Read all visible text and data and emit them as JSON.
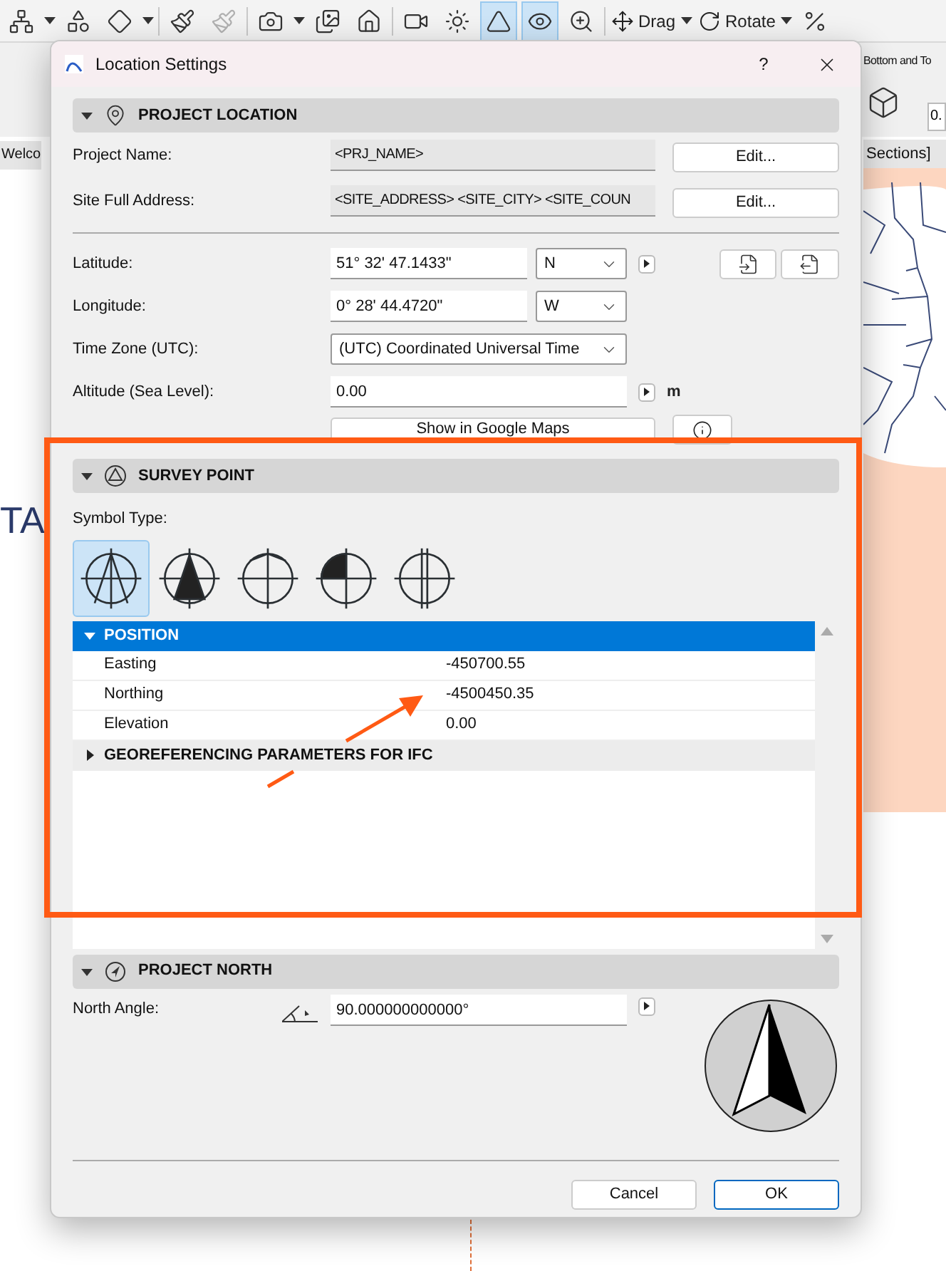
{
  "toolbar": {
    "items": [
      {
        "kind": "icon",
        "selected": false,
        "disabled": false
      },
      {
        "kind": "caret"
      },
      {
        "kind": "icon",
        "selected": false,
        "disabled": false
      },
      {
        "kind": "icon",
        "selected": false,
        "disabled": false
      },
      {
        "kind": "caret"
      },
      {
        "kind": "separator"
      },
      {
        "kind": "icon",
        "selected": false,
        "disabled": false
      },
      {
        "kind": "icon",
        "selected": false,
        "disabled": true
      },
      {
        "kind": "separator"
      },
      {
        "kind": "icon",
        "selected": false,
        "disabled": false
      },
      {
        "kind": "caret"
      },
      {
        "kind": "icon",
        "selected": false,
        "disabled": false
      },
      {
        "kind": "icon",
        "selected": false,
        "disabled": false
      },
      {
        "kind": "separator"
      },
      {
        "kind": "icon",
        "selected": false,
        "disabled": false
      },
      {
        "kind": "icon",
        "selected": false,
        "disabled": false
      },
      {
        "kind": "icon",
        "selected": true,
        "disabled": false
      },
      {
        "kind": "icon",
        "selected": true,
        "disabled": false
      },
      {
        "kind": "icon",
        "selected": false,
        "disabled": false
      },
      {
        "kind": "separator"
      },
      {
        "kind": "labeled",
        "label": "Drag"
      },
      {
        "kind": "caret"
      },
      {
        "kind": "labeled",
        "label": "Rotate"
      },
      {
        "kind": "caret"
      },
      {
        "kind": "icon",
        "selected": false,
        "disabled": false
      }
    ]
  },
  "background": {
    "left_tab": "Welco",
    "left_heading": "TA",
    "right_label": "Bottom and To",
    "right_value": "0.",
    "right_tab": "Sections]"
  },
  "dialog": {
    "title": "Location Settings",
    "help": "?",
    "project_location": {
      "title": "PROJECT LOCATION",
      "expanded": true,
      "project_name": {
        "label": "Project Name:",
        "value": "<PRJ_NAME>",
        "button": "Edit..."
      },
      "site_address": {
        "label": "Site Full Address:",
        "value": "<SITE_ADDRESS>  <SITE_CITY>  <SITE_COUN",
        "button": "Edit..."
      },
      "latitude": {
        "label": "Latitude:",
        "value": "51° 32' 47.1433\"",
        "direction": "N"
      },
      "longitude": {
        "label": "Longitude:",
        "value": "0° 28' 44.4720\"",
        "direction": "W"
      },
      "time_zone": {
        "label": "Time Zone (UTC):",
        "value": "(UTC) Coordinated Universal Time"
      },
      "altitude": {
        "label": "Altitude (Sea Level):",
        "value": "0.00",
        "unit": "m"
      },
      "maps_button": "Show in Google Maps"
    },
    "survey_point": {
      "title": "SURVEY POINT",
      "expanded": true,
      "symbol_label": "Symbol Type:",
      "symbols": [
        {
          "selected": true
        },
        {
          "selected": false
        },
        {
          "selected": false
        },
        {
          "selected": false
        },
        {
          "selected": false
        }
      ],
      "tree": [
        {
          "label": "POSITION",
          "expanded": true,
          "selected": true,
          "children": [
            {
              "label": "Easting",
              "value": "-450700.55"
            },
            {
              "label": "Northing",
              "value": "-4500450.35"
            },
            {
              "label": "Elevation",
              "value": "0.00"
            }
          ]
        },
        {
          "label": "GEOREFERENCING PARAMETERS FOR IFC",
          "expanded": false,
          "selected": false
        }
      ]
    },
    "project_north": {
      "title": "PROJECT NORTH",
      "expanded": true,
      "label": "North Angle:",
      "value": "90.000000000000°"
    },
    "buttons": [
      {
        "label": "Cancel",
        "default": false
      },
      {
        "label": "OK",
        "default": true
      }
    ]
  }
}
